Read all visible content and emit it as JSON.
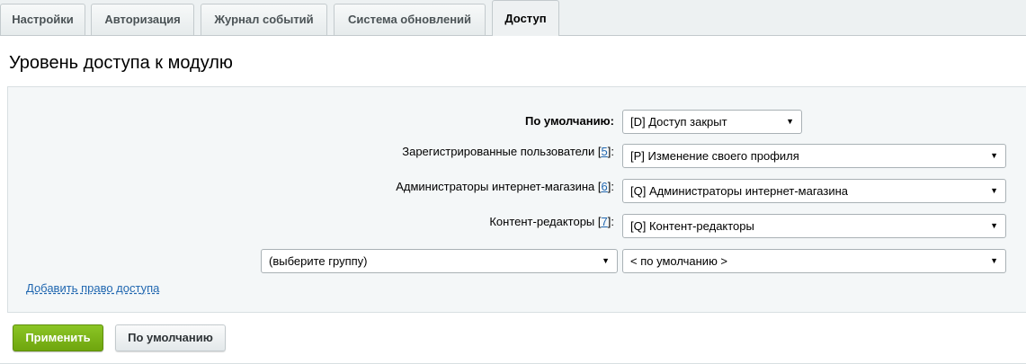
{
  "tabs": [
    {
      "label": "Настройки",
      "active": false
    },
    {
      "label": "Авторизация",
      "active": false
    },
    {
      "label": "Журнал событий",
      "active": false
    },
    {
      "label": "Система обновлений",
      "active": false
    },
    {
      "label": "Доступ",
      "active": true
    }
  ],
  "page_title": "Уровень доступа к модулю",
  "rows": [
    {
      "label": "По умолчанию:",
      "value": "[D] Доступ закрыт"
    },
    {
      "label": "Зарегистрированные пользователи",
      "group_id": "5",
      "value": "[P] Изменение своего профиля"
    },
    {
      "label": "Администраторы интернет-магазина",
      "group_id": "6",
      "value": "[Q] Администраторы интернет-магазина"
    },
    {
      "label": "Контент-редакторы",
      "group_id": "7",
      "value": "[Q] Контент-редакторы"
    }
  ],
  "new_row": {
    "group_placeholder": "(выберите группу)",
    "access_value": "< по умолчанию >"
  },
  "bracket_open": "[",
  "bracket_close": "]:",
  "dropdown_arrow": "▼",
  "add_access_link": "Добавить право доступа",
  "buttons": {
    "apply": "Применить",
    "default": "По умолчанию"
  },
  "colors": {
    "accent_green": "#7ab51d",
    "link_blue": "#2067b0",
    "panel_bg": "#f4f7f8"
  }
}
